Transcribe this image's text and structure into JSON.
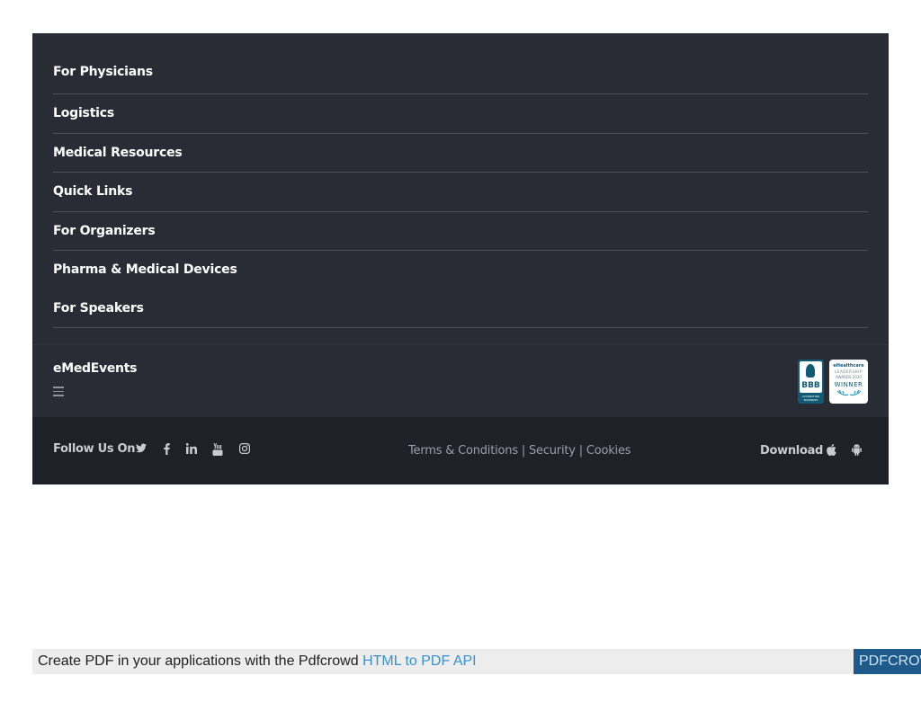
{
  "footer": {
    "nav_items": [
      {
        "label": "For Physicians"
      },
      {
        "label": "Logistics"
      },
      {
        "label": "Medical Resources"
      },
      {
        "label": "Quick Links"
      },
      {
        "label": "For Organizers"
      },
      {
        "label": "Pharma & Medical Devices"
      },
      {
        "label": "For Speakers"
      }
    ],
    "brand": {
      "name": "eMedEvents",
      "menu_icon": "hamburger-icon"
    },
    "badges": {
      "bbb": {
        "text": "BBB",
        "subtext": "ACCREDITED BUSINESS"
      },
      "ehealthcare": {
        "line1": "eHealthcare",
        "line2": "LEADERSHIP",
        "line3": "AWARDS 2020",
        "line4": "WINNER"
      }
    },
    "bottom_bar": {
      "follow_label": "Follow Us On",
      "social_icons": [
        "twitter-icon",
        "facebook-icon",
        "linkedin-icon",
        "youtube-icon",
        "instagram-icon"
      ],
      "links": {
        "terms": "Terms & Conditions",
        "security": "Security",
        "cookies": "Cookies",
        "separator": "|"
      },
      "download_label": "Download",
      "app_icons": [
        "apple-icon",
        "android-icon"
      ]
    },
    "colors": {
      "background": "#292c35",
      "bottom_bar": "#1f2128",
      "separator": "#4a4e58"
    }
  },
  "pdfcrowd": {
    "text": "Create PDF in your applications with the Pdfcrowd",
    "link_text": "HTML to PDF API",
    "button_text": "PDFCROWD"
  }
}
